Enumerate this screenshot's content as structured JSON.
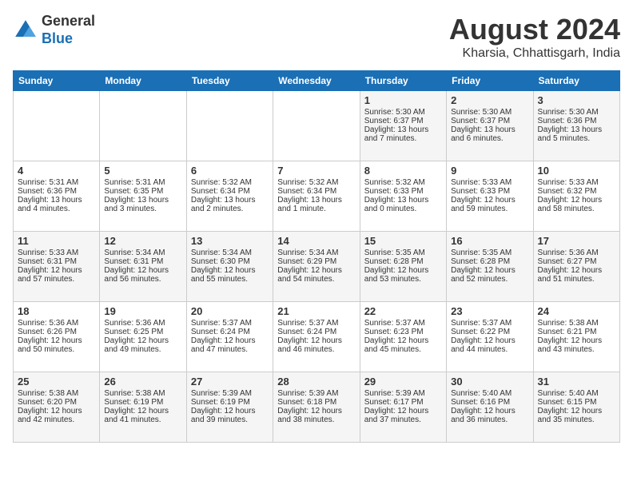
{
  "header": {
    "logo_line1": "General",
    "logo_line2": "Blue",
    "month_year": "August 2024",
    "location": "Kharsia, Chhattisgarh, India"
  },
  "days_of_week": [
    "Sunday",
    "Monday",
    "Tuesday",
    "Wednesday",
    "Thursday",
    "Friday",
    "Saturday"
  ],
  "weeks": [
    [
      {
        "day": "",
        "content": ""
      },
      {
        "day": "",
        "content": ""
      },
      {
        "day": "",
        "content": ""
      },
      {
        "day": "",
        "content": ""
      },
      {
        "day": "1",
        "content": "Sunrise: 5:30 AM\nSunset: 6:37 PM\nDaylight: 13 hours\nand 7 minutes."
      },
      {
        "day": "2",
        "content": "Sunrise: 5:30 AM\nSunset: 6:37 PM\nDaylight: 13 hours\nand 6 minutes."
      },
      {
        "day": "3",
        "content": "Sunrise: 5:30 AM\nSunset: 6:36 PM\nDaylight: 13 hours\nand 5 minutes."
      }
    ],
    [
      {
        "day": "4",
        "content": "Sunrise: 5:31 AM\nSunset: 6:36 PM\nDaylight: 13 hours\nand 4 minutes."
      },
      {
        "day": "5",
        "content": "Sunrise: 5:31 AM\nSunset: 6:35 PM\nDaylight: 13 hours\nand 3 minutes."
      },
      {
        "day": "6",
        "content": "Sunrise: 5:32 AM\nSunset: 6:34 PM\nDaylight: 13 hours\nand 2 minutes."
      },
      {
        "day": "7",
        "content": "Sunrise: 5:32 AM\nSunset: 6:34 PM\nDaylight: 13 hours\nand 1 minute."
      },
      {
        "day": "8",
        "content": "Sunrise: 5:32 AM\nSunset: 6:33 PM\nDaylight: 13 hours\nand 0 minutes."
      },
      {
        "day": "9",
        "content": "Sunrise: 5:33 AM\nSunset: 6:33 PM\nDaylight: 12 hours\nand 59 minutes."
      },
      {
        "day": "10",
        "content": "Sunrise: 5:33 AM\nSunset: 6:32 PM\nDaylight: 12 hours\nand 58 minutes."
      }
    ],
    [
      {
        "day": "11",
        "content": "Sunrise: 5:33 AM\nSunset: 6:31 PM\nDaylight: 12 hours\nand 57 minutes."
      },
      {
        "day": "12",
        "content": "Sunrise: 5:34 AM\nSunset: 6:31 PM\nDaylight: 12 hours\nand 56 minutes."
      },
      {
        "day": "13",
        "content": "Sunrise: 5:34 AM\nSunset: 6:30 PM\nDaylight: 12 hours\nand 55 minutes."
      },
      {
        "day": "14",
        "content": "Sunrise: 5:34 AM\nSunset: 6:29 PM\nDaylight: 12 hours\nand 54 minutes."
      },
      {
        "day": "15",
        "content": "Sunrise: 5:35 AM\nSunset: 6:28 PM\nDaylight: 12 hours\nand 53 minutes."
      },
      {
        "day": "16",
        "content": "Sunrise: 5:35 AM\nSunset: 6:28 PM\nDaylight: 12 hours\nand 52 minutes."
      },
      {
        "day": "17",
        "content": "Sunrise: 5:36 AM\nSunset: 6:27 PM\nDaylight: 12 hours\nand 51 minutes."
      }
    ],
    [
      {
        "day": "18",
        "content": "Sunrise: 5:36 AM\nSunset: 6:26 PM\nDaylight: 12 hours\nand 50 minutes."
      },
      {
        "day": "19",
        "content": "Sunrise: 5:36 AM\nSunset: 6:25 PM\nDaylight: 12 hours\nand 49 minutes."
      },
      {
        "day": "20",
        "content": "Sunrise: 5:37 AM\nSunset: 6:24 PM\nDaylight: 12 hours\nand 47 minutes."
      },
      {
        "day": "21",
        "content": "Sunrise: 5:37 AM\nSunset: 6:24 PM\nDaylight: 12 hours\nand 46 minutes."
      },
      {
        "day": "22",
        "content": "Sunrise: 5:37 AM\nSunset: 6:23 PM\nDaylight: 12 hours\nand 45 minutes."
      },
      {
        "day": "23",
        "content": "Sunrise: 5:37 AM\nSunset: 6:22 PM\nDaylight: 12 hours\nand 44 minutes."
      },
      {
        "day": "24",
        "content": "Sunrise: 5:38 AM\nSunset: 6:21 PM\nDaylight: 12 hours\nand 43 minutes."
      }
    ],
    [
      {
        "day": "25",
        "content": "Sunrise: 5:38 AM\nSunset: 6:20 PM\nDaylight: 12 hours\nand 42 minutes."
      },
      {
        "day": "26",
        "content": "Sunrise: 5:38 AM\nSunset: 6:19 PM\nDaylight: 12 hours\nand 41 minutes."
      },
      {
        "day": "27",
        "content": "Sunrise: 5:39 AM\nSunset: 6:19 PM\nDaylight: 12 hours\nand 39 minutes."
      },
      {
        "day": "28",
        "content": "Sunrise: 5:39 AM\nSunset: 6:18 PM\nDaylight: 12 hours\nand 38 minutes."
      },
      {
        "day": "29",
        "content": "Sunrise: 5:39 AM\nSunset: 6:17 PM\nDaylight: 12 hours\nand 37 minutes."
      },
      {
        "day": "30",
        "content": "Sunrise: 5:40 AM\nSunset: 6:16 PM\nDaylight: 12 hours\nand 36 minutes."
      },
      {
        "day": "31",
        "content": "Sunrise: 5:40 AM\nSunset: 6:15 PM\nDaylight: 12 hours\nand 35 minutes."
      }
    ]
  ]
}
